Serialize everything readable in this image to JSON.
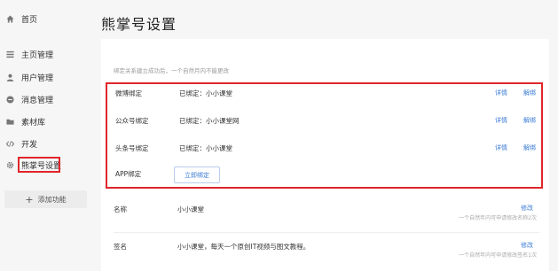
{
  "sidebar": {
    "items": [
      {
        "label": "首页",
        "icon": "home-icon"
      },
      {
        "label": "主页管理",
        "icon": "list-icon"
      },
      {
        "label": "用户管理",
        "icon": "user-icon"
      },
      {
        "label": "消息管理",
        "icon": "message-icon"
      },
      {
        "label": "素材库",
        "icon": "folder-icon"
      },
      {
        "label": "开发",
        "icon": "code-icon"
      },
      {
        "label": "熊掌号设置",
        "icon": "gear-icon"
      }
    ],
    "add_label": "添加功能"
  },
  "page": {
    "title": "熊掌号设置",
    "notice": "绑定关系建立成功后，一个自然月内不能更改"
  },
  "bindings": [
    {
      "label": "微博绑定",
      "value": "已绑定：小小课堂",
      "detail": "详情",
      "unbind": "解绑"
    },
    {
      "label": "公众号绑定",
      "value": "已绑定：小小课堂网",
      "detail": "详情",
      "unbind": "解绑"
    },
    {
      "label": "头条号绑定",
      "value": "已绑定：小小课堂",
      "detail": "详情",
      "unbind": "解绑"
    },
    {
      "label": "APP绑定",
      "button": "立即绑定"
    }
  ],
  "info": [
    {
      "label": "名称",
      "value": "小小课堂",
      "edit": "修改",
      "hint": "一个自然年内可申请修改名称2次"
    },
    {
      "label": "签名",
      "value": "小小课堂，每天一个原创IT视频与图文教程。",
      "edit": "修改",
      "hint": "一个自然年内可申请修改签名1次"
    }
  ],
  "colors": {
    "accent": "#3a7bd5",
    "highlight": "#e0252b"
  }
}
